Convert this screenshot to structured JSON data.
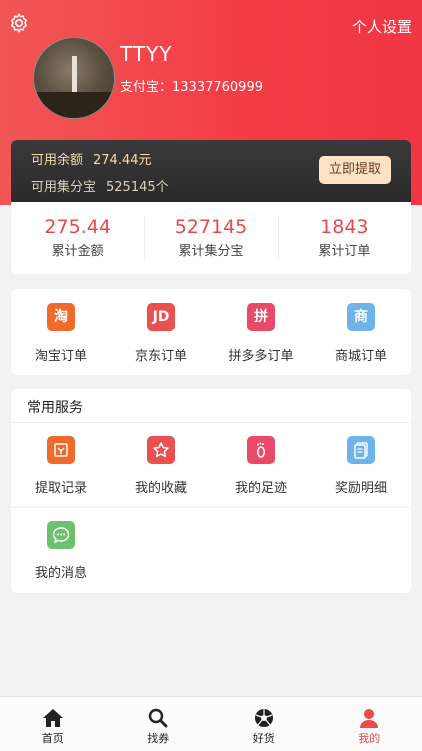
{
  "header": {
    "settings_label": "个人设置",
    "username": "TTYY",
    "alipay_label": "支付宝：",
    "alipay_account": "13337760999"
  },
  "balance": {
    "available_label": "可用余额",
    "available_value": "274.44元",
    "points_label": "可用集分宝",
    "points_value": "525145个",
    "withdraw_button": "立即提取"
  },
  "stats": [
    {
      "value": "275.44",
      "label": "累计金额"
    },
    {
      "value": "527145",
      "label": "累计集分宝"
    },
    {
      "value": "1843",
      "label": "累计订单"
    }
  ],
  "orders": [
    {
      "glyph": "淘",
      "label": "淘宝订单",
      "color": "#f06a2a",
      "icon": "taobao-icon"
    },
    {
      "glyph": "JD",
      "label": "京东订单",
      "color": "#e9504f",
      "icon": "jd-icon"
    },
    {
      "glyph": "拼",
      "label": "拼多多订单",
      "color": "#e84a67",
      "icon": "pinduoduo-icon"
    },
    {
      "glyph": "商",
      "label": "商城订单",
      "color": "#6fb3e8",
      "icon": "mall-icon"
    }
  ],
  "services": {
    "title": "常用服务",
    "items": [
      {
        "label": "提取记录",
        "color": "#f06a2a",
        "icon": "withdraw-record-icon"
      },
      {
        "label": "我的收藏",
        "color": "#e9504f",
        "icon": "star-icon"
      },
      {
        "label": "我的足迹",
        "color": "#e84a67",
        "icon": "footprint-icon"
      },
      {
        "label": "奖励明细",
        "color": "#6fb3e8",
        "icon": "reward-detail-icon"
      },
      {
        "label": "我的消息",
        "color": "#6dc06d",
        "icon": "message-icon"
      }
    ]
  },
  "tabbar": {
    "items": [
      {
        "label": "首页",
        "icon": "home-icon"
      },
      {
        "label": "找券",
        "icon": "search-icon"
      },
      {
        "label": "好货",
        "icon": "aperture-icon"
      },
      {
        "label": "我的",
        "icon": "user-icon"
      }
    ],
    "active_color": "#e94b4b"
  }
}
